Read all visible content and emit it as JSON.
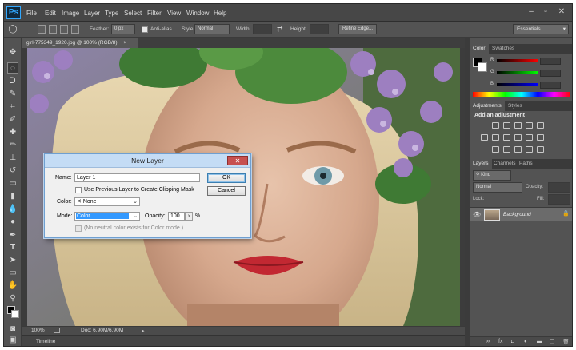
{
  "app": {
    "logo": "Ps"
  },
  "menu": [
    "File",
    "Edit",
    "Image",
    "Layer",
    "Type",
    "Select",
    "Filter",
    "View",
    "Window",
    "Help"
  ],
  "window_controls": {
    "minimize": "–",
    "maximize": "▫",
    "close": "✕"
  },
  "options": {
    "feather_label": "Feather:",
    "feather_value": "0 px",
    "antialias_label": "Anti-alias",
    "style_label": "Style:",
    "style_value": "Normal",
    "width_label": "Width:",
    "height_label": "Height:",
    "refine_edge_label": "Refine Edge...",
    "workspace": "Essentials"
  },
  "document": {
    "tab_title": "girl-775349_1920.jpg @ 100% (RGB/8)",
    "tab_close": "×",
    "zoom": "100%",
    "doc_info": "Doc: 6.90M/6.90M"
  },
  "timeline": {
    "label": "Timeline"
  },
  "color_panel": {
    "tabs": [
      "Color",
      "Swatches"
    ],
    "channels": [
      {
        "label": "R",
        "color": "#ff0000"
      },
      {
        "label": "G",
        "color": "#00ff00"
      },
      {
        "label": "B",
        "color": "#0000ff"
      }
    ]
  },
  "adjustments_panel": {
    "tabs": [
      "Adjustments",
      "Styles"
    ],
    "heading": "Add an adjustment"
  },
  "layers_panel": {
    "tabs": [
      "Layers",
      "Channels",
      "Paths"
    ],
    "filter_value": "Kind",
    "blend_mode": "Normal",
    "opacity_label": "Opacity:",
    "lock_label": "Lock:",
    "fill_label": "Fill:",
    "layers": [
      {
        "name": "Background"
      }
    ]
  },
  "dialog": {
    "title": "New Layer",
    "close": "✕",
    "name_label": "Name:",
    "name_value": "Layer 1",
    "ok_label": "OK",
    "cancel_label": "Cancel",
    "clipping_mask_label": "Use Previous Layer to Create Clipping Mask",
    "color_label": "Color:",
    "color_value": "None",
    "color_x": "✕",
    "mode_label": "Mode:",
    "mode_value": "Color",
    "opacity_label": "Opacity:",
    "opacity_value": "100",
    "opacity_stepper": "›",
    "opacity_unit": "%",
    "neutral_label": "(No neutral color exists for Color mode.)"
  },
  "colors": {
    "dialog_title_bg": "#c4dcf5",
    "mode_selected_bg": "#3399ff",
    "close_red": "#c75050"
  }
}
